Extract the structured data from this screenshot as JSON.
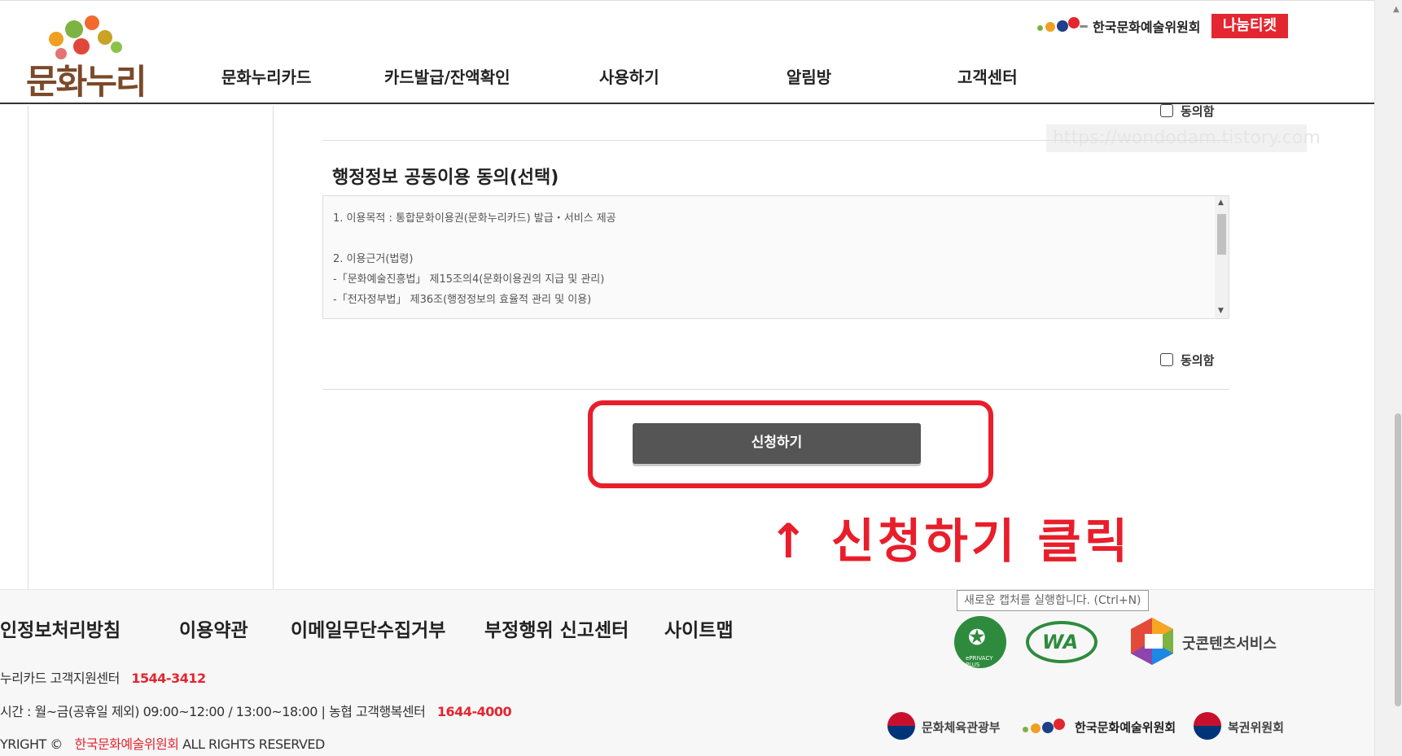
{
  "header": {
    "logo_text": "문화누리",
    "nav": [
      "문화누리카드",
      "카드발급/잔액확인",
      "사용하기",
      "알림방",
      "고객센터"
    ],
    "brand_org": "한국문화예술위원회",
    "brand_ticket": "나눔티켓"
  },
  "consent": {
    "prev_agree_label": "동의함",
    "section_title": "행정정보 공동이용 동의(선택)",
    "lines": [
      "1. 이용목적 : 통합문화이용권(문화누리카드) 발급・서비스 제공",
      "2. 이용근거(법령)",
      "-「문화예술진흥법」 제15조의4(문화이용권의 지급 및 관리)",
      "-「전자정부법」 제36조(행정정보의 효율적 관리 및 이용)"
    ],
    "agree_label": "동의함"
  },
  "watermark": "https://wondodam.tistory.com",
  "apply_button": "신청하기",
  "annotation": "↑ 신청하기 클릭",
  "footer": {
    "links": [
      "인정보처리방침",
      "이용약관",
      "이메일무단수집거부",
      "부정행위 신고센터",
      "사이트맵"
    ],
    "support_label": "누리카드 고객지원센터",
    "support_phone": "1544-3412",
    "hours_label": "시간 : 월~금(공휴일 제외) 09:00~12:00 / 13:00~18:00  |  농협 고객행복센터",
    "nh_phone": "1644-4000",
    "copyright_prefix": "YRIGHT ©",
    "copyright_org": "한국문화예술위원회",
    "copyright_suffix": "ALL RIGHTS RESERVED",
    "capture_tip": "새로운 캡처를 실행합니다. (Ctrl+N)",
    "cert_eprivacy_small": "ePRIVACY PLUS",
    "cert_wa": "WA",
    "cert_goodcontents": "굿콘텐츠서비스",
    "gov_logos": [
      "문화체육관광부",
      "한국문화예술위원회",
      "복권위원회"
    ]
  },
  "colors": {
    "accent_red": "#e81e2a",
    "button_bg": "#555555",
    "logo_brown": "#7b4a2a",
    "cert_green": "#2e8b3e"
  }
}
